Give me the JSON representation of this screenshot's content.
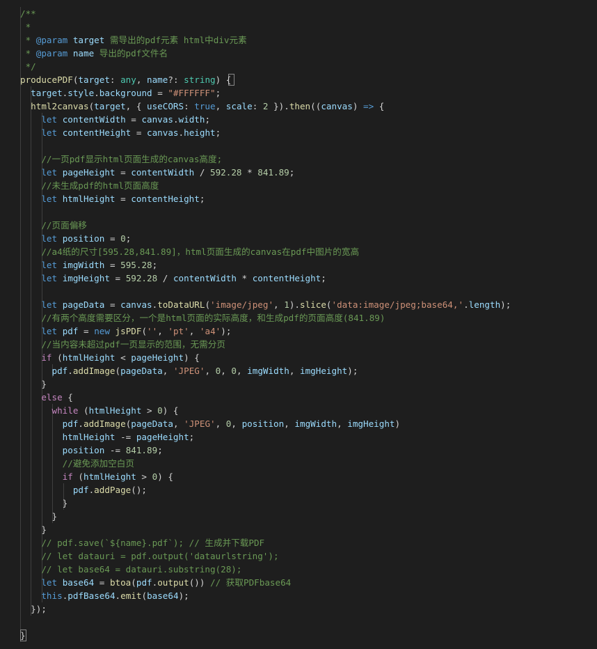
{
  "colors": {
    "background": "#1e1e1e",
    "comment": "#6a9955",
    "keyword": "#569cd6",
    "control": "#c586c0",
    "function": "#dcdcaa",
    "variable": "#9cdcfe",
    "type": "#4ec9b0",
    "string": "#ce9178",
    "number": "#b5cea8",
    "text": "#d4d4d4"
  },
  "lines": [
    [
      [
        "doc",
        "/**"
      ]
    ],
    [
      [
        "doc",
        " *"
      ]
    ],
    [
      [
        "doc",
        " * "
      ],
      [
        "doc-tag",
        "@param"
      ],
      [
        "doc",
        " "
      ],
      [
        "doc-param",
        "target"
      ],
      [
        "doc",
        " 需导出的pdf元素 html中div元素"
      ]
    ],
    [
      [
        "doc",
        " * "
      ],
      [
        "doc-tag",
        "@param"
      ],
      [
        "doc",
        " "
      ],
      [
        "doc-param",
        "name"
      ],
      [
        "doc",
        " 导出的pdf文件名"
      ]
    ],
    [
      [
        "doc",
        " */"
      ]
    ],
    [
      [
        "fn",
        "producePDF"
      ],
      [
        "punc",
        "("
      ],
      [
        "var",
        "target"
      ],
      [
        "punc",
        ": "
      ],
      [
        "type",
        "any"
      ],
      [
        "punc",
        ", "
      ],
      [
        "var",
        "name"
      ],
      [
        "punc",
        "?: "
      ],
      [
        "type",
        "string"
      ],
      [
        "punc",
        ") {"
      ]
    ],
    [
      [
        "plain",
        "  "
      ],
      [
        "var",
        "target"
      ],
      [
        "punc",
        "."
      ],
      [
        "prop",
        "style"
      ],
      [
        "punc",
        "."
      ],
      [
        "prop",
        "background"
      ],
      [
        "punc",
        " = "
      ],
      [
        "str",
        "\"#FFFFFF\""
      ],
      [
        "punc",
        ";"
      ]
    ],
    [
      [
        "plain",
        "  "
      ],
      [
        "fn",
        "html2canvas"
      ],
      [
        "punc",
        "("
      ],
      [
        "var",
        "target"
      ],
      [
        "punc",
        ", { "
      ],
      [
        "prop",
        "useCORS"
      ],
      [
        "punc",
        ": "
      ],
      [
        "kw",
        "true"
      ],
      [
        "punc",
        ", "
      ],
      [
        "prop",
        "scale"
      ],
      [
        "punc",
        ": "
      ],
      [
        "num",
        "2"
      ],
      [
        "punc",
        " })."
      ],
      [
        "fn",
        "then"
      ],
      [
        "punc",
        "(("
      ],
      [
        "var",
        "canvas"
      ],
      [
        "punc",
        ") "
      ],
      [
        "kw",
        "=>"
      ],
      [
        "punc",
        " {"
      ]
    ],
    [
      [
        "plain",
        "    "
      ],
      [
        "kw",
        "let"
      ],
      [
        "plain",
        " "
      ],
      [
        "var",
        "contentWidth"
      ],
      [
        "punc",
        " = "
      ],
      [
        "var",
        "canvas"
      ],
      [
        "punc",
        "."
      ],
      [
        "prop",
        "width"
      ],
      [
        "punc",
        ";"
      ]
    ],
    [
      [
        "plain",
        "    "
      ],
      [
        "kw",
        "let"
      ],
      [
        "plain",
        " "
      ],
      [
        "var",
        "contentHeight"
      ],
      [
        "punc",
        " = "
      ],
      [
        "var",
        "canvas"
      ],
      [
        "punc",
        "."
      ],
      [
        "prop",
        "height"
      ],
      [
        "punc",
        ";"
      ]
    ],
    [],
    [
      [
        "plain",
        "    "
      ],
      [
        "comment",
        "//一页pdf显示html页面生成的canvas高度;"
      ]
    ],
    [
      [
        "plain",
        "    "
      ],
      [
        "kw",
        "let"
      ],
      [
        "plain",
        " "
      ],
      [
        "var",
        "pageHeight"
      ],
      [
        "punc",
        " = "
      ],
      [
        "var",
        "contentWidth"
      ],
      [
        "punc",
        " / "
      ],
      [
        "num",
        "592.28"
      ],
      [
        "punc",
        " * "
      ],
      [
        "num",
        "841.89"
      ],
      [
        "punc",
        ";"
      ]
    ],
    [
      [
        "plain",
        "    "
      ],
      [
        "comment",
        "//未生成pdf的html页面高度"
      ]
    ],
    [
      [
        "plain",
        "    "
      ],
      [
        "kw",
        "let"
      ],
      [
        "plain",
        " "
      ],
      [
        "var",
        "htmlHeight"
      ],
      [
        "punc",
        " = "
      ],
      [
        "var",
        "contentHeight"
      ],
      [
        "punc",
        ";"
      ]
    ],
    [],
    [
      [
        "plain",
        "    "
      ],
      [
        "comment",
        "//页面偏移"
      ]
    ],
    [
      [
        "plain",
        "    "
      ],
      [
        "kw",
        "let"
      ],
      [
        "plain",
        " "
      ],
      [
        "var",
        "position"
      ],
      [
        "punc",
        " = "
      ],
      [
        "num",
        "0"
      ],
      [
        "punc",
        ";"
      ]
    ],
    [
      [
        "plain",
        "    "
      ],
      [
        "comment",
        "//a4纸的尺寸[595.28,841.89]，html页面生成的canvas在pdf中图片的宽高"
      ]
    ],
    [
      [
        "plain",
        "    "
      ],
      [
        "kw",
        "let"
      ],
      [
        "plain",
        " "
      ],
      [
        "var",
        "imgWidth"
      ],
      [
        "punc",
        " = "
      ],
      [
        "num",
        "595.28"
      ],
      [
        "punc",
        ";"
      ]
    ],
    [
      [
        "plain",
        "    "
      ],
      [
        "kw",
        "let"
      ],
      [
        "plain",
        " "
      ],
      [
        "var",
        "imgHeight"
      ],
      [
        "punc",
        " = "
      ],
      [
        "num",
        "592.28"
      ],
      [
        "punc",
        " / "
      ],
      [
        "var",
        "contentWidth"
      ],
      [
        "punc",
        " * "
      ],
      [
        "var",
        "contentHeight"
      ],
      [
        "punc",
        ";"
      ]
    ],
    [],
    [
      [
        "plain",
        "    "
      ],
      [
        "kw",
        "let"
      ],
      [
        "plain",
        " "
      ],
      [
        "var",
        "pageData"
      ],
      [
        "punc",
        " = "
      ],
      [
        "var",
        "canvas"
      ],
      [
        "punc",
        "."
      ],
      [
        "fn",
        "toDataURL"
      ],
      [
        "punc",
        "("
      ],
      [
        "str",
        "'image/jpeg'"
      ],
      [
        "punc",
        ", "
      ],
      [
        "num",
        "1"
      ],
      [
        "punc",
        ")."
      ],
      [
        "fn",
        "slice"
      ],
      [
        "punc",
        "("
      ],
      [
        "str",
        "'data:image/jpeg;base64,'"
      ],
      [
        "punc",
        "."
      ],
      [
        "prop",
        "length"
      ],
      [
        "punc",
        ");"
      ]
    ],
    [
      [
        "plain",
        "    "
      ],
      [
        "comment",
        "//有两个高度需要区分，一个是html页面的实际高度，和生成pdf的页面高度(841.89)"
      ]
    ],
    [
      [
        "plain",
        "    "
      ],
      [
        "kw",
        "let"
      ],
      [
        "plain",
        " "
      ],
      [
        "var",
        "pdf"
      ],
      [
        "punc",
        " = "
      ],
      [
        "kw",
        "new"
      ],
      [
        "plain",
        " "
      ],
      [
        "fn",
        "jsPDF"
      ],
      [
        "punc",
        "("
      ],
      [
        "str",
        "''"
      ],
      [
        "punc",
        ", "
      ],
      [
        "str",
        "'pt'"
      ],
      [
        "punc",
        ", "
      ],
      [
        "str",
        "'a4'"
      ],
      [
        "punc",
        ");"
      ]
    ],
    [
      [
        "plain",
        "    "
      ],
      [
        "comment",
        "//当内容未超过pdf一页显示的范围，无需分页"
      ]
    ],
    [
      [
        "plain",
        "    "
      ],
      [
        "ctrl",
        "if"
      ],
      [
        "punc",
        " ("
      ],
      [
        "var",
        "htmlHeight"
      ],
      [
        "punc",
        " < "
      ],
      [
        "var",
        "pageHeight"
      ],
      [
        "punc",
        ") {"
      ]
    ],
    [
      [
        "plain",
        "      "
      ],
      [
        "var",
        "pdf"
      ],
      [
        "punc",
        "."
      ],
      [
        "fn",
        "addImage"
      ],
      [
        "punc",
        "("
      ],
      [
        "var",
        "pageData"
      ],
      [
        "punc",
        ", "
      ],
      [
        "str",
        "'JPEG'"
      ],
      [
        "punc",
        ", "
      ],
      [
        "num",
        "0"
      ],
      [
        "punc",
        ", "
      ],
      [
        "num",
        "0"
      ],
      [
        "punc",
        ", "
      ],
      [
        "var",
        "imgWidth"
      ],
      [
        "punc",
        ", "
      ],
      [
        "var",
        "imgHeight"
      ],
      [
        "punc",
        ");"
      ]
    ],
    [
      [
        "plain",
        "    "
      ],
      [
        "punc",
        "}"
      ]
    ],
    [
      [
        "plain",
        "    "
      ],
      [
        "ctrl",
        "else"
      ],
      [
        "punc",
        " {"
      ]
    ],
    [
      [
        "plain",
        "      "
      ],
      [
        "ctrl",
        "while"
      ],
      [
        "punc",
        " ("
      ],
      [
        "var",
        "htmlHeight"
      ],
      [
        "punc",
        " > "
      ],
      [
        "num",
        "0"
      ],
      [
        "punc",
        ") {"
      ]
    ],
    [
      [
        "plain",
        "        "
      ],
      [
        "var",
        "pdf"
      ],
      [
        "punc",
        "."
      ],
      [
        "fn",
        "addImage"
      ],
      [
        "punc",
        "("
      ],
      [
        "var",
        "pageData"
      ],
      [
        "punc",
        ", "
      ],
      [
        "str",
        "'JPEG'"
      ],
      [
        "punc",
        ", "
      ],
      [
        "num",
        "0"
      ],
      [
        "punc",
        ", "
      ],
      [
        "var",
        "position"
      ],
      [
        "punc",
        ", "
      ],
      [
        "var",
        "imgWidth"
      ],
      [
        "punc",
        ", "
      ],
      [
        "var",
        "imgHeight"
      ],
      [
        "punc",
        ")"
      ]
    ],
    [
      [
        "plain",
        "        "
      ],
      [
        "var",
        "htmlHeight"
      ],
      [
        "punc",
        " -= "
      ],
      [
        "var",
        "pageHeight"
      ],
      [
        "punc",
        ";"
      ]
    ],
    [
      [
        "plain",
        "        "
      ],
      [
        "var",
        "position"
      ],
      [
        "punc",
        " -= "
      ],
      [
        "num",
        "841.89"
      ],
      [
        "punc",
        ";"
      ]
    ],
    [
      [
        "plain",
        "        "
      ],
      [
        "comment",
        "//避免添加空白页"
      ]
    ],
    [
      [
        "plain",
        "        "
      ],
      [
        "ctrl",
        "if"
      ],
      [
        "punc",
        " ("
      ],
      [
        "var",
        "htmlHeight"
      ],
      [
        "punc",
        " > "
      ],
      [
        "num",
        "0"
      ],
      [
        "punc",
        ") {"
      ]
    ],
    [
      [
        "plain",
        "          "
      ],
      [
        "var",
        "pdf"
      ],
      [
        "punc",
        "."
      ],
      [
        "fn",
        "addPage"
      ],
      [
        "punc",
        "();"
      ]
    ],
    [
      [
        "plain",
        "        "
      ],
      [
        "punc",
        "}"
      ]
    ],
    [
      [
        "plain",
        "      "
      ],
      [
        "punc",
        "}"
      ]
    ],
    [
      [
        "plain",
        "    "
      ],
      [
        "punc",
        "}"
      ]
    ],
    [
      [
        "plain",
        "    "
      ],
      [
        "comment",
        "// pdf.save(`${name}.pdf`); // 生成并下载PDF"
      ]
    ],
    [
      [
        "plain",
        "    "
      ],
      [
        "comment",
        "// let datauri = pdf.output('dataurlstring');"
      ]
    ],
    [
      [
        "plain",
        "    "
      ],
      [
        "comment",
        "// let base64 = datauri.substring(28);"
      ]
    ],
    [
      [
        "plain",
        "    "
      ],
      [
        "kw",
        "let"
      ],
      [
        "plain",
        " "
      ],
      [
        "var",
        "base64"
      ],
      [
        "punc",
        " = "
      ],
      [
        "fn",
        "btoa"
      ],
      [
        "punc",
        "("
      ],
      [
        "var",
        "pdf"
      ],
      [
        "punc",
        "."
      ],
      [
        "fn",
        "output"
      ],
      [
        "punc",
        "()) "
      ],
      [
        "comment",
        "// 获取PDFbase64"
      ]
    ],
    [
      [
        "plain",
        "    "
      ],
      [
        "kw",
        "this"
      ],
      [
        "punc",
        "."
      ],
      [
        "prop",
        "pdfBase64"
      ],
      [
        "punc",
        "."
      ],
      [
        "fn",
        "emit"
      ],
      [
        "punc",
        "("
      ],
      [
        "var",
        "base64"
      ],
      [
        "punc",
        ");"
      ]
    ],
    [
      [
        "plain",
        "  "
      ],
      [
        "punc",
        "});"
      ]
    ],
    [],
    [
      [
        "punc",
        "}"
      ]
    ]
  ]
}
